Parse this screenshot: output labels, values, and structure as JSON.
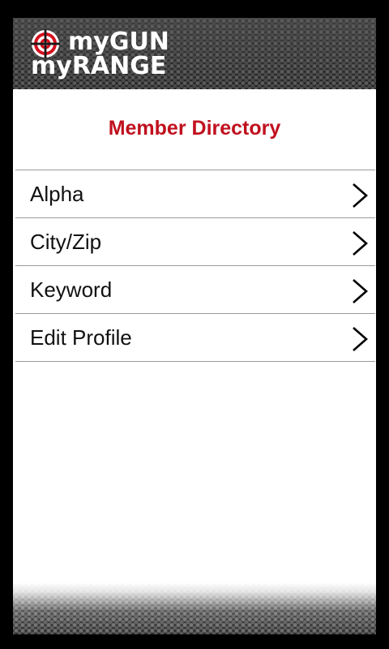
{
  "app": {
    "logo_line1": "myGUN",
    "logo_line2": "myRANGE",
    "logo_icon": "crosshair-target-icon"
  },
  "page": {
    "title": "Member Directory"
  },
  "menu": {
    "items": [
      {
        "label": "Alpha",
        "icon": "chevron-right-icon"
      },
      {
        "label": "City/Zip",
        "icon": "chevron-right-icon"
      },
      {
        "label": "Keyword",
        "icon": "chevron-right-icon"
      },
      {
        "label": "Edit Profile",
        "icon": "chevron-right-icon"
      }
    ]
  },
  "colors": {
    "title": "#c0101e",
    "logo_red": "#d6111f",
    "header_bg": "#2a2a2a",
    "divider": "#9a9a9a"
  }
}
